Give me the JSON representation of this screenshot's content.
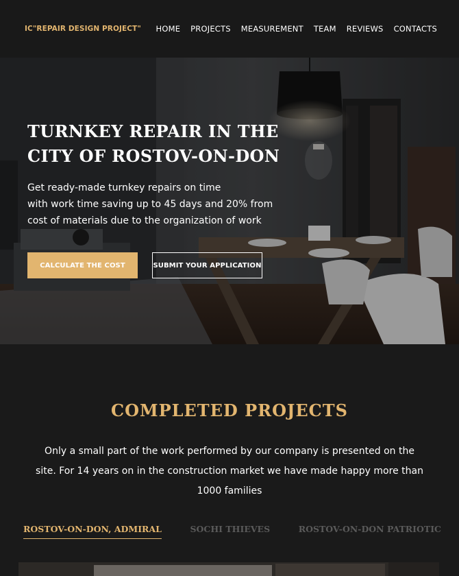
{
  "header": {
    "logo": "IC\"REPAIR DESIGN PROJECT\"",
    "nav": [
      "HOME",
      "PROJECTS",
      "MEASUREMENT",
      "TEAM",
      "REVIEWS",
      "CONTACTS"
    ]
  },
  "hero": {
    "title_line1": "TURNKEY REPAIR IN THE",
    "title_line2": "CITY OF ROSTOV-ON-DON",
    "desc_line1": "Get ready-made turnkey repairs on time",
    "desc_line2": "with work time saving up to 45 days and 20% from",
    "desc_line3": "cost of materials due to the organization of work",
    "btn_primary": "CALCULATE THE COST",
    "btn_secondary": "SUBMIT YOUR APPLICATION"
  },
  "projects": {
    "title": "COMPLETED PROJECTS",
    "text_line1": "Only a small part of the work performed by our company is presented on the",
    "text_line2": "site. For 14 years on in the construction market we have made happy more than",
    "text_line3": "1000 families",
    "tabs": [
      "ROSTOV-ON-DON, ADMIRAL",
      "SOCHI THIEVES",
      "ROSTOV-ON-DON PATRIOTIC"
    ]
  },
  "colors": {
    "accent": "#e2b56f",
    "background": "#1a1a1a",
    "header": "#191919"
  }
}
